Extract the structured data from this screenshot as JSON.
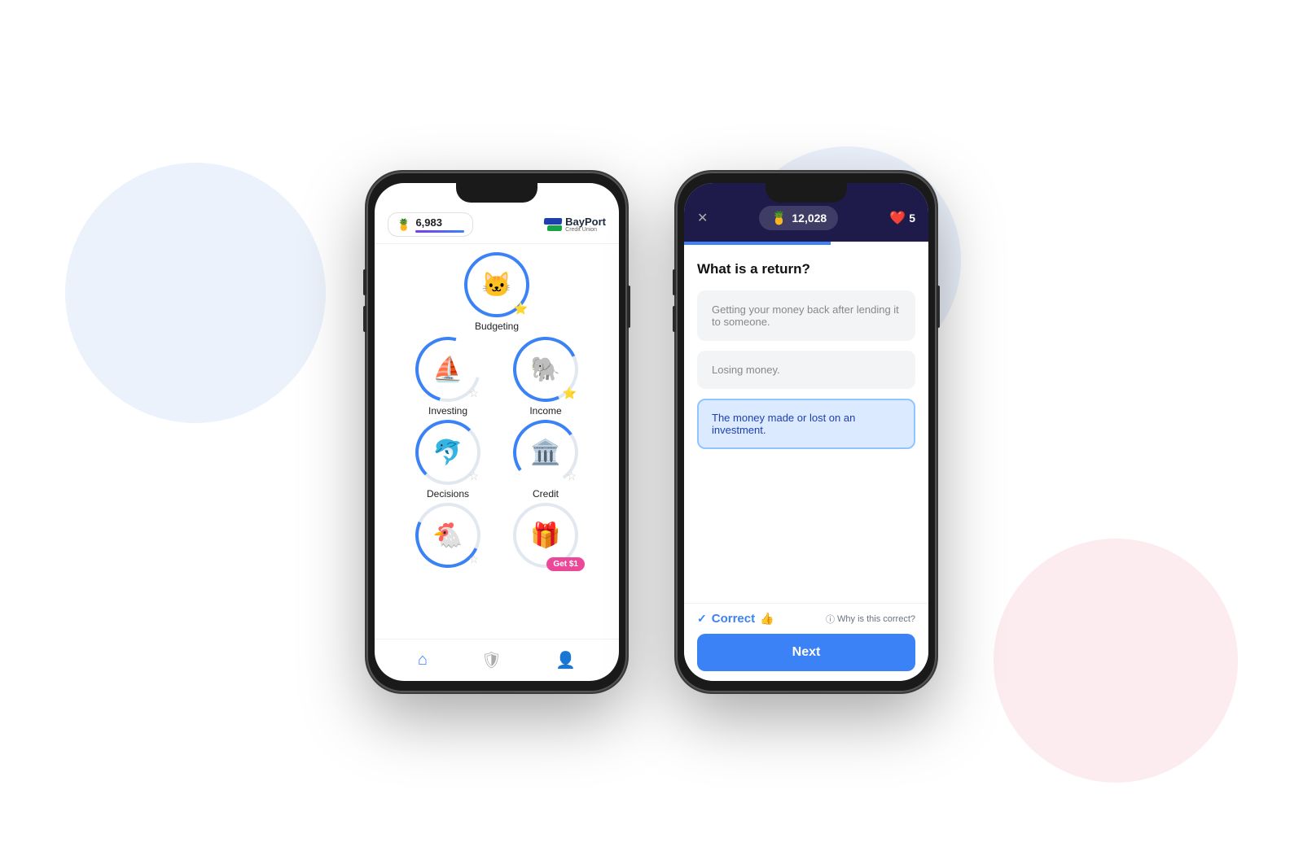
{
  "background": {
    "blob_colors": [
      "#c8daf5",
      "#c8daf5",
      "#f5c8d0"
    ]
  },
  "phone1": {
    "header": {
      "score_icon": "🍍",
      "score_value": "6,983",
      "logo_name": "BayPort",
      "logo_sub": "Credit Union"
    },
    "menu": [
      {
        "id": "budgeting",
        "label": "Budgeting",
        "emoji": "🐱",
        "ring": "full",
        "star": "⭐",
        "star_visible": true
      },
      {
        "id": "investing",
        "label": "Investing",
        "emoji": "⛵",
        "ring": "partial-invest",
        "star": "☆",
        "star_visible": true
      },
      {
        "id": "income",
        "label": "Income",
        "emoji": "🐘",
        "ring": "partial-income",
        "star": "⭐",
        "star_visible": true
      },
      {
        "id": "decisions",
        "label": "Decisions",
        "emoji": "🐬",
        "ring": "partial-decisions",
        "star": "☆",
        "star_visible": true
      },
      {
        "id": "credit",
        "label": "Credit",
        "emoji": "🏛️",
        "ring": "partial-credit",
        "star": "☆",
        "star_visible": true
      },
      {
        "id": "bottom1",
        "label": "",
        "emoji": "🐔",
        "ring": "partial-bottom1",
        "star": "☆",
        "star_visible": true
      },
      {
        "id": "bottom2",
        "label": "",
        "emoji": "🎁",
        "ring": "partial-bottom2",
        "star": "",
        "star_visible": false,
        "get_dollar": "Get $1",
        "has_badge": true
      }
    ],
    "nav": {
      "items": [
        "home",
        "shield",
        "person"
      ]
    }
  },
  "phone2": {
    "header": {
      "score_icon": "🍍",
      "score_value": "12,028",
      "lives_icon": "❤️",
      "lives_value": "5"
    },
    "question": "What is a return?",
    "answers": [
      {
        "id": "a1",
        "text": "Getting your money back after lending it to someone.",
        "state": "default"
      },
      {
        "id": "a2",
        "text": "Losing money.",
        "state": "default"
      },
      {
        "id": "a3",
        "text": "The money made or lost on an investment.",
        "state": "selected"
      }
    ],
    "footer": {
      "correct_label": "Correct",
      "thumbs_icon": "👍",
      "why_label": "Why is this correct?",
      "next_label": "Next"
    }
  }
}
